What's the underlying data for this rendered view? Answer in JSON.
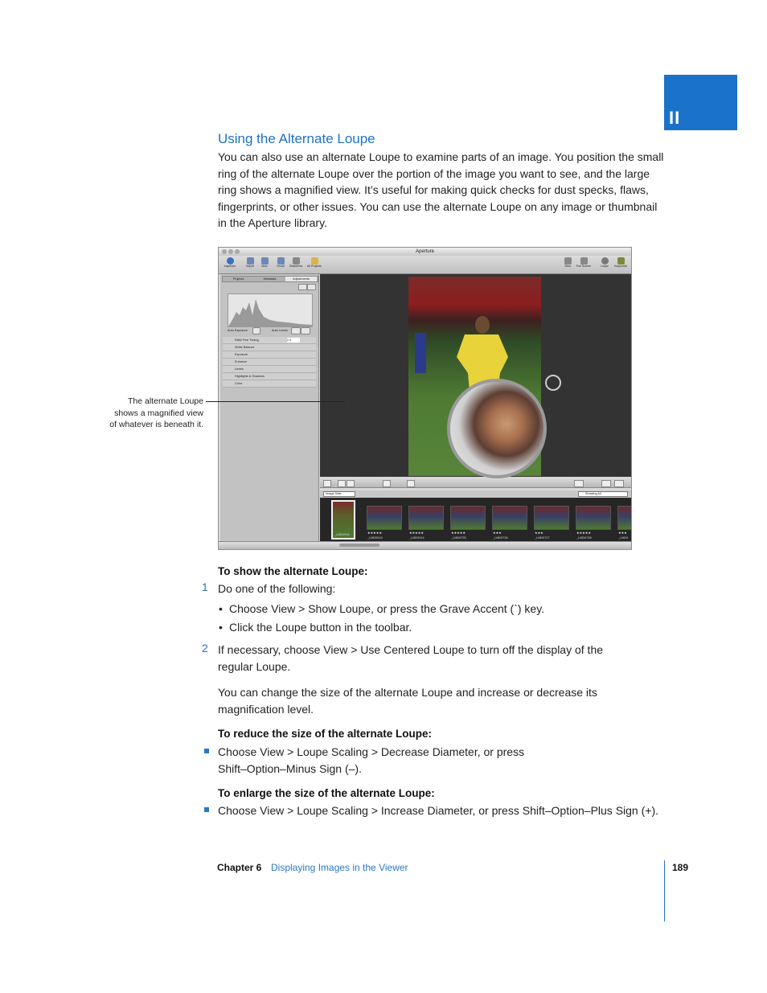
{
  "part_tab": {
    "label": "II"
  },
  "section": {
    "title": "Using the Alternate Loupe",
    "intro_lines": [
      "You can also use an alternate Loupe to examine parts of an image. You position the small",
      "ring of the alternate Loupe over the portion of the image you want to see, and the large",
      "ring shows a magnified view. It’s useful for making quick checks for dust specks, flaws,",
      "fingerprints, or other issues. You can use the alternate Loupe on any image or thumbnail",
      "in the Aperture library."
    ]
  },
  "screenshot": {
    "window_title": "Aperture",
    "toolbar_left": [
      "Inspector",
      "Import",
      "New",
      "Email",
      "Slideshow",
      "All Projects"
    ],
    "toolbar_right": [
      "View",
      "Full Screen",
      "Loupe",
      "Keywords"
    ],
    "inspector_tabs": [
      "Projects",
      "Metadata",
      "Adjustments"
    ],
    "auto_exposure": "Auto Exposure",
    "auto_levels": "Auto Levels",
    "adjustments": [
      "RAW Fine Tuning",
      "White Balance",
      "Exposure",
      "Enhance",
      "Levels",
      "Highlights & Shadows",
      "Color"
    ],
    "raw_value": "2.0",
    "rating_badge": "★★★★★",
    "sort_select": "Image Date",
    "showing_select": "Showing All",
    "thumbnails": [
      {
        "stars": "",
        "caption": "_LMD0916"
      },
      {
        "stars": "★★★★★",
        "caption": "_LMD0913"
      },
      {
        "stars": "★★★★★",
        "caption": "_LMD0914"
      },
      {
        "stars": "★★★★★",
        "caption": "_LMD0725"
      },
      {
        "stars": "★★★",
        "caption": "_LMD0726"
      },
      {
        "stars": "★★★",
        "caption": "_LMD0727"
      },
      {
        "stars": "★★★★★",
        "caption": "_LMD0728"
      },
      {
        "stars": "★★★",
        "caption": "_LMD0"
      }
    ]
  },
  "callout": {
    "lines": [
      "The alternate Loupe",
      "shows a magnified view",
      "of whatever is beneath it."
    ]
  },
  "task1": {
    "title": "To show the alternate Loupe:",
    "step1_num": "1",
    "step1_text": "Do one of the following:",
    "bullet1": "Choose View > Show Loupe, or press the Grave Accent (`) key.",
    "bullet2": "Click the Loupe button in the toolbar.",
    "step2_num": "2",
    "step2_line1": "If necessary, choose View > Use Centered Loupe to turn off the display of the",
    "step2_line2": "regular Loupe.",
    "note_line1": "You can change the size of the alternate Loupe and increase or decrease its",
    "note_line2": "magnification level."
  },
  "task2": {
    "title": "To reduce the size of the alternate Loupe:",
    "line1": "Choose View > Loupe Scaling > Decrease Diameter, or press",
    "line2": "Shift–Option–Minus Sign (–)."
  },
  "task3": {
    "title": "To enlarge the size of the alternate Loupe:",
    "line1": "Choose View > Loupe Scaling > Increase Diameter, or press Shift–Option–Plus Sign (+)."
  },
  "footer": {
    "chapter": "Chapter 6",
    "chapter_title": "Displaying Images in the Viewer",
    "page": "189"
  },
  "colors": {
    "accent": "#1f72c4",
    "tab": "#1a73c8"
  }
}
